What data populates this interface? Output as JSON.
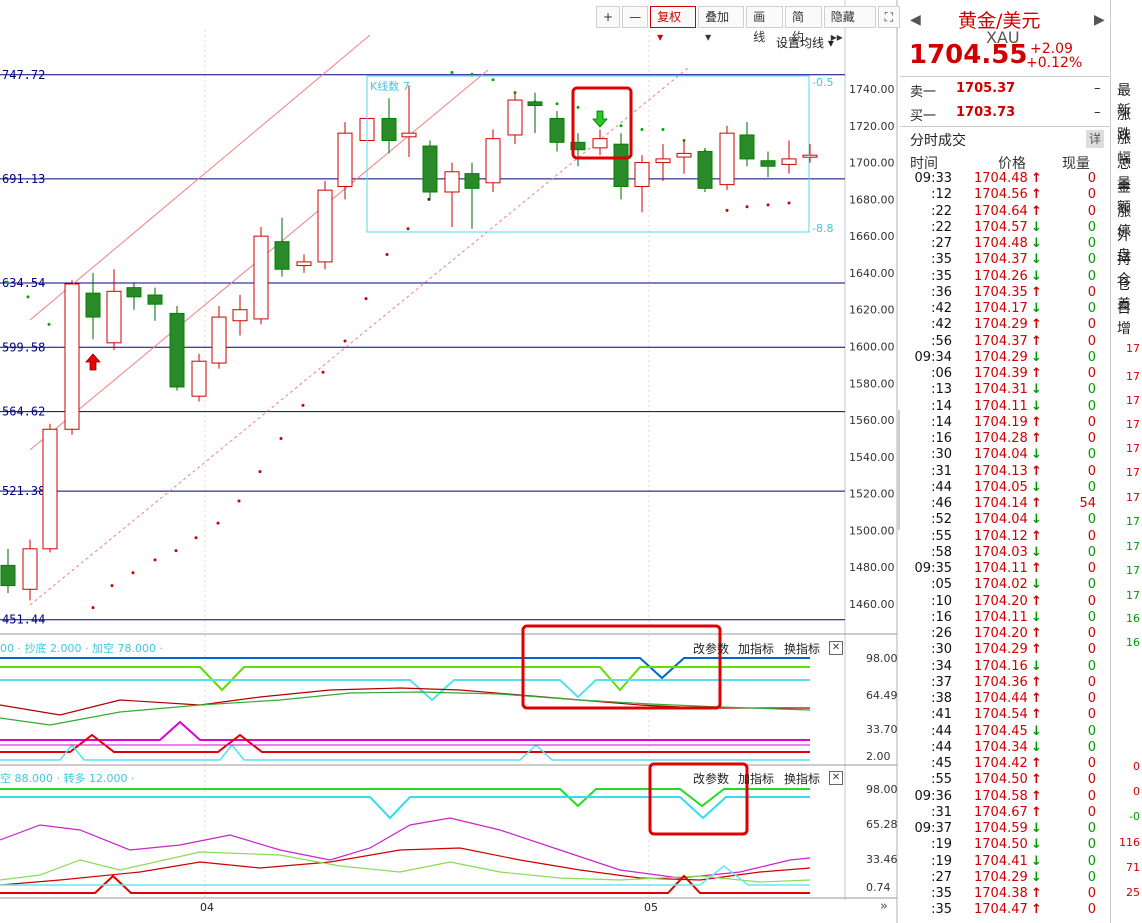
{
  "toolbar": {
    "plus": "+",
    "minus": "—",
    "fuquan": "复权",
    "diejia": "叠加",
    "huaxian": "画线",
    "jianyue": "简约",
    "yincang": "隐藏",
    "set_ma": "设置均线"
  },
  "main_chart": {
    "level_labels": [
      "747.72",
      "691.13",
      "634.54",
      "599.58",
      "564.62",
      "521.38",
      "451.44"
    ],
    "price_axis": [
      "1740.00",
      "1720.00",
      "1700.00",
      "1680.00",
      "1660.00",
      "1640.00",
      "1620.00",
      "1600.00",
      "1580.00",
      "1560.00",
      "1540.00",
      "1520.00",
      "1500.00",
      "1480.00",
      "1460.00"
    ],
    "box_label": "K线数 7",
    "box_right_top": "-0.5",
    "box_right_bottom": "-8.8"
  },
  "indicator1": {
    "legend": "00 · 抄底 2.000 · 加空 78.000 ·",
    "axis": [
      "98.00",
      "64.49",
      "33.70",
      "2.00"
    ],
    "btn_params": "改参数",
    "btn_add": "加指标",
    "btn_switch": "换指标"
  },
  "indicator2": {
    "legend": "空 88.000 · 转多 12.000 ·",
    "axis": [
      "98.00",
      "65.28",
      "33.46",
      "0.74"
    ],
    "btn_params": "改参数",
    "btn_add": "加指标",
    "btn_switch": "换指标"
  },
  "time_axis": [
    "04",
    "05"
  ],
  "quote": {
    "name": "黄金/美元",
    "code": "XAU",
    "price": "1704.55",
    "change": "+2.09",
    "change_pct": "+0.12%",
    "ask_label": "卖一",
    "ask": "1705.37",
    "bid_label": "买一",
    "bid": "1703.73",
    "dash": "–",
    "trades_title": "分时成交",
    "detail_btn": "详",
    "col_time": "时间",
    "col_price": "价格",
    "col_vol": "现量",
    "trades": [
      {
        "t": "09:33",
        "p": "1704.48",
        "d": "up",
        "v": "0"
      },
      {
        "t": ":12",
        "p": "1704.56",
        "d": "up",
        "v": "0"
      },
      {
        "t": ":22",
        "p": "1704.64",
        "d": "up",
        "v": "0"
      },
      {
        "t": ":22",
        "p": "1704.57",
        "d": "dn",
        "v": "0"
      },
      {
        "t": ":27",
        "p": "1704.48",
        "d": "dn",
        "v": "0"
      },
      {
        "t": ":35",
        "p": "1704.37",
        "d": "dn",
        "v": "0"
      },
      {
        "t": ":35",
        "p": "1704.26",
        "d": "dn",
        "v": "0"
      },
      {
        "t": ":36",
        "p": "1704.35",
        "d": "up",
        "v": "0"
      },
      {
        "t": ":42",
        "p": "1704.17",
        "d": "dn",
        "v": "0"
      },
      {
        "t": ":42",
        "p": "1704.29",
        "d": "up",
        "v": "0"
      },
      {
        "t": ":56",
        "p": "1704.37",
        "d": "up",
        "v": "0"
      },
      {
        "t": "09:34",
        "p": "1704.29",
        "d": "dn",
        "v": "0"
      },
      {
        "t": ":06",
        "p": "1704.39",
        "d": "up",
        "v": "0"
      },
      {
        "t": ":13",
        "p": "1704.31",
        "d": "dn",
        "v": "0"
      },
      {
        "t": ":14",
        "p": "1704.11",
        "d": "dn",
        "v": "0"
      },
      {
        "t": ":14",
        "p": "1704.19",
        "d": "up",
        "v": "0"
      },
      {
        "t": ":16",
        "p": "1704.28",
        "d": "up",
        "v": "0"
      },
      {
        "t": ":30",
        "p": "1704.04",
        "d": "dn",
        "v": "0"
      },
      {
        "t": ":31",
        "p": "1704.13",
        "d": "up",
        "v": "0"
      },
      {
        "t": ":44",
        "p": "1704.05",
        "d": "dn",
        "v": "0"
      },
      {
        "t": ":46",
        "p": "1704.14",
        "d": "up",
        "v": "54"
      },
      {
        "t": ":52",
        "p": "1704.04",
        "d": "dn",
        "v": "0"
      },
      {
        "t": ":55",
        "p": "1704.12",
        "d": "up",
        "v": "0"
      },
      {
        "t": ":58",
        "p": "1704.03",
        "d": "dn",
        "v": "0"
      },
      {
        "t": "09:35",
        "p": "1704.11",
        "d": "up",
        "v": "0"
      },
      {
        "t": ":05",
        "p": "1704.02",
        "d": "dn",
        "v": "0"
      },
      {
        "t": ":10",
        "p": "1704.20",
        "d": "up",
        "v": "0"
      },
      {
        "t": ":16",
        "p": "1704.11",
        "d": "dn",
        "v": "0"
      },
      {
        "t": ":26",
        "p": "1704.20",
        "d": "up",
        "v": "0"
      },
      {
        "t": ":30",
        "p": "1704.29",
        "d": "up",
        "v": "0"
      },
      {
        "t": ":34",
        "p": "1704.16",
        "d": "dn",
        "v": "0"
      },
      {
        "t": ":37",
        "p": "1704.36",
        "d": "up",
        "v": "0"
      },
      {
        "t": ":38",
        "p": "1704.44",
        "d": "up",
        "v": "0"
      },
      {
        "t": ":41",
        "p": "1704.54",
        "d": "up",
        "v": "0"
      },
      {
        "t": ":44",
        "p": "1704.45",
        "d": "dn",
        "v": "0"
      },
      {
        "t": ":44",
        "p": "1704.34",
        "d": "dn",
        "v": "0"
      },
      {
        "t": ":45",
        "p": "1704.42",
        "d": "up",
        "v": "0"
      },
      {
        "t": ":55",
        "p": "1704.50",
        "d": "up",
        "v": "0"
      },
      {
        "t": "09:36",
        "p": "1704.58",
        "d": "up",
        "v": "0"
      },
      {
        "t": ":31",
        "p": "1704.67",
        "d": "up",
        "v": "0"
      },
      {
        "t": "09:37",
        "p": "1704.59",
        "d": "dn",
        "v": "0"
      },
      {
        "t": ":19",
        "p": "1704.50",
        "d": "dn",
        "v": "0"
      },
      {
        "t": ":19",
        "p": "1704.41",
        "d": "dn",
        "v": "0"
      },
      {
        "t": ":27",
        "p": "1704.29",
        "d": "dn",
        "v": "0"
      },
      {
        "t": ":35",
        "p": "1704.38",
        "d": "up",
        "v": "0"
      },
      {
        "t": ":35",
        "p": "1704.47",
        "d": "up",
        "v": "0"
      }
    ],
    "side_labels": [
      "最新",
      "涨跌",
      "涨幅",
      "总量",
      "金额",
      "涨停",
      "外盘",
      "持仓",
      "仓差",
      "日增"
    ],
    "side_numbers": [
      "17",
      "17",
      "17",
      "17",
      "17",
      "17",
      "17",
      "17",
      "17",
      "17",
      "17",
      "16",
      "16",
      "0",
      "0",
      "-0",
      "116",
      "71",
      "25"
    ]
  },
  "colors": {
    "up": "#d00000",
    "down": "#009a00",
    "level_line": "#000080",
    "box": "#55d8e8",
    "annotation": "#e00000"
  }
}
